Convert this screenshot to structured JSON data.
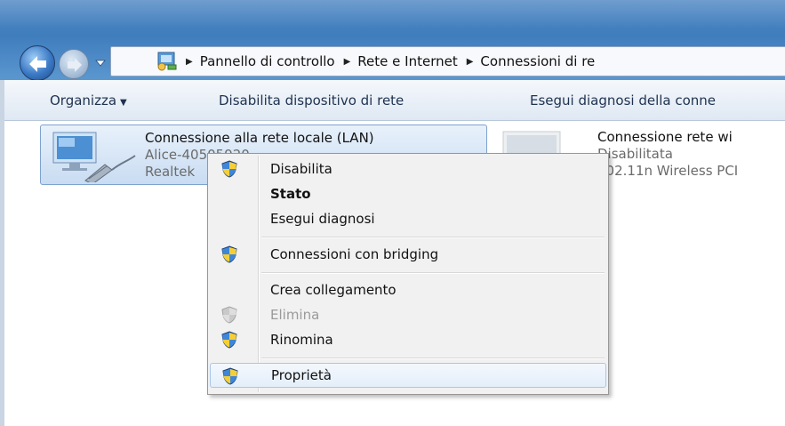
{
  "address": {
    "crumbs": [
      "Pannello di controllo",
      "Rete e Internet",
      "Connessioni di re"
    ]
  },
  "toolbar": {
    "organize_label": "Organizza",
    "disable_label": "Disabilita dispositivo di rete",
    "diagnose_label": "Esegui diagnosi della conne"
  },
  "connections": [
    {
      "name": "Connessione alla rete locale (LAN)",
      "sub1": "Alice-40505920",
      "sub2": "Realtek"
    },
    {
      "name": "Connessione rete wi",
      "sub1": "Disabilitata",
      "sub2": "802.11n Wireless PCI"
    }
  ],
  "context_menu": {
    "items": [
      {
        "label": "Disabilita",
        "icon": "uac-shield-icon"
      },
      {
        "label": "Stato",
        "bold": true
      },
      {
        "label": "Esegui diagnosi"
      },
      {
        "label": "Connessioni con bridging",
        "icon": "uac-shield-icon"
      },
      {
        "label": "Crea collegamento"
      },
      {
        "label": "Elimina",
        "icon": "uac-shield-icon",
        "disabled": true
      },
      {
        "label": "Rinomina",
        "icon": "uac-shield-icon"
      },
      {
        "label": "Proprietà",
        "icon": "uac-shield-icon",
        "highlighted": true
      }
    ]
  },
  "colors": {
    "titlebar": "#3f7dbd",
    "selection_border": "#7da2ce",
    "menu_background": "#f1f1f1",
    "disabled_text": "#9a9a9a"
  }
}
